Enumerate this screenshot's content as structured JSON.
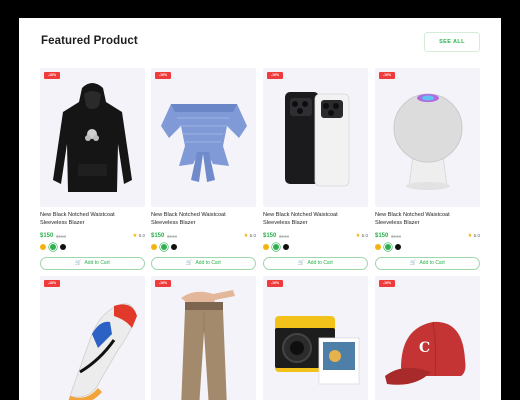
{
  "header": {
    "title": "Featured Product",
    "see_all_label": "SEE ALL"
  },
  "colors": {
    "accent_green": "#2fb14f",
    "badge_red": "#f13b3b",
    "star": "#f5b30f"
  },
  "products": [
    {
      "badge": "-10%",
      "name": "New Black Notched Waistcoat Sleeveless Blazer",
      "price": "$150",
      "old_price": "$150",
      "rating": "5.0",
      "cart_label": "Add to Cart",
      "image": "black hoodie"
    },
    {
      "badge": "-10%",
      "name": "New Black Notched Waistcoat Sleeveless Blazer",
      "price": "$150",
      "old_price": "$150",
      "rating": "5.0",
      "cart_label": "Add to Cart",
      "image": "blue striped off-shoulder top"
    },
    {
      "badge": "-10%",
      "name": "New Black Notched Waistcoat Sleeveless Blazer",
      "price": "$150",
      "old_price": "$150",
      "rating": "5.0",
      "cart_label": "Add to Cart",
      "image": "black and white smartphones"
    },
    {
      "badge": "-10%",
      "name": "New Black Notched Waistcoat Sleeveless Blazer",
      "price": "$150",
      "old_price": "$150",
      "rating": "5.0",
      "cart_label": "Add to Cart",
      "image": "smart speaker"
    },
    {
      "badge": "-10%",
      "image": "running sneaker"
    },
    {
      "badge": "-10%",
      "image": "beige trousers"
    },
    {
      "badge": "-10%",
      "image": "instant camera"
    },
    {
      "badge": "-10%",
      "image": "red baseball cap"
    }
  ]
}
